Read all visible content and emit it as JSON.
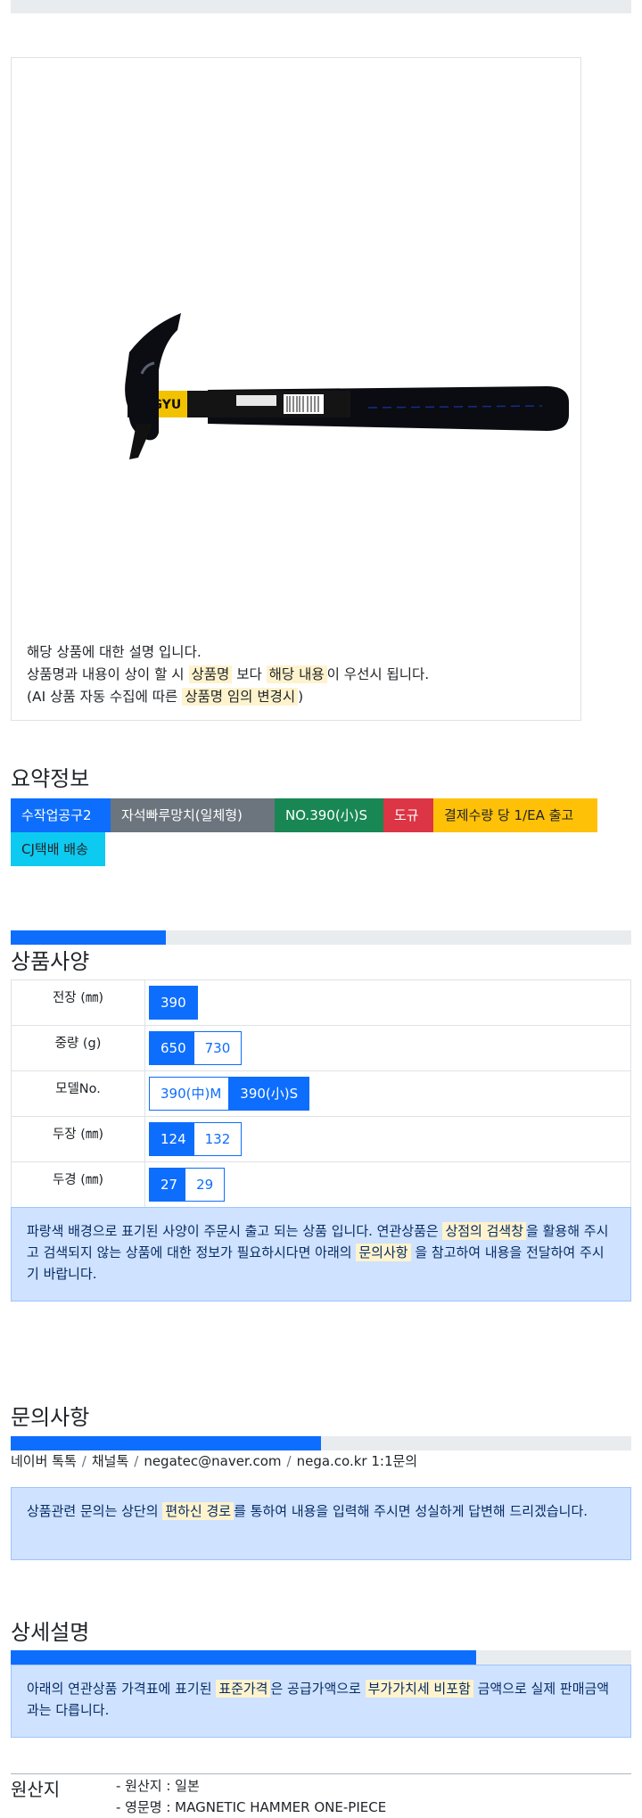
{
  "image_description": {
    "line1": "해당 상품에 대한 설명 입니다.",
    "line2_a": "상품명과 내용이 상이 할 시 ",
    "line2_hl1": "상품명",
    "line2_b": " 보다 ",
    "line2_hl2": "해당 내용",
    "line2_c": "이 우선시 됩니다.",
    "line3_a": "(AI 상품 자동 수집에 따른 ",
    "line3_hl": "상품명 임의 변경시",
    "line3_b": ")",
    "product_image_brand": "DOGYU"
  },
  "summary": {
    "title": "요약정보",
    "badges": [
      {
        "label": "수작업공구2",
        "color": "#0d6efd"
      },
      {
        "label": "자석빠루망치(일체형)",
        "color": "#6c757d"
      },
      {
        "label": "NO.390(小)S",
        "color": "#198754"
      },
      {
        "label": "도규",
        "color": "#dc3545"
      },
      {
        "label": "결제수량 당 1/EA 출고",
        "color": "#ffc107"
      },
      {
        "label": "CJ택배 배송",
        "color": "#0dcaf0"
      }
    ]
  },
  "specs": {
    "title": "상품사양",
    "progress": 0.25,
    "rows": [
      {
        "label": "전장 (㎜)",
        "options": [
          {
            "value": "390",
            "selected": true
          }
        ]
      },
      {
        "label": "중량 (g)",
        "options": [
          {
            "value": "650",
            "selected": true
          },
          {
            "value": "730",
            "selected": false
          }
        ]
      },
      {
        "label": "모델No.",
        "options": [
          {
            "value": "390(中)M",
            "selected": false
          },
          {
            "value": "390(小)S",
            "selected": true
          }
        ]
      },
      {
        "label": "두장 (㎜)",
        "options": [
          {
            "value": "124",
            "selected": true
          },
          {
            "value": "132",
            "selected": false
          }
        ]
      },
      {
        "label": "두경 (㎜)",
        "options": [
          {
            "value": "27",
            "selected": true
          },
          {
            "value": "29",
            "selected": false
          }
        ]
      }
    ],
    "notice_a": "파랑색 배경으로 표기된 사양이 주문시 출고 되는 상품 입니다. 연관상품은 ",
    "notice_hl1": "상점의 검색창",
    "notice_b": "을 활용해 주시고 검색되지 않는 상품에 대한 정보가 필요하시다면 아래의 ",
    "notice_hl2": "문의사항",
    "notice_c": " 을 참고하여 내용을 전달하여 주시기 바랍니다."
  },
  "inquiry": {
    "title": "문의사항",
    "progress": 0.5,
    "channels": [
      "네이버 톡톡",
      "채널톡",
      "negatec@naver.com",
      "nega.co.kr 1:1문의"
    ],
    "separator": "/",
    "notice_a": "상품관련 문의는 상단의 ",
    "notice_hl": "편하신 경로",
    "notice_b": "를 통하여 내용을 입력해 주시면 성실하게 답변해 드리겠습니다."
  },
  "detail": {
    "title": "상세설명",
    "progress": 0.75,
    "notice_a": "아래의 연관상품 가격표에 표기된 ",
    "notice_hl1": "표준가격",
    "notice_b": "은 공급가액으로 ",
    "notice_hl2": "부가가치세 비포함",
    "notice_c": " 금액으로 실제 판매금액과는 다릅니다."
  },
  "origin": {
    "label": "원산지",
    "items": [
      "- 원산지 : 일본",
      "- 영문명 : MAGNETIC HAMMER ONE-PIECE"
    ]
  }
}
